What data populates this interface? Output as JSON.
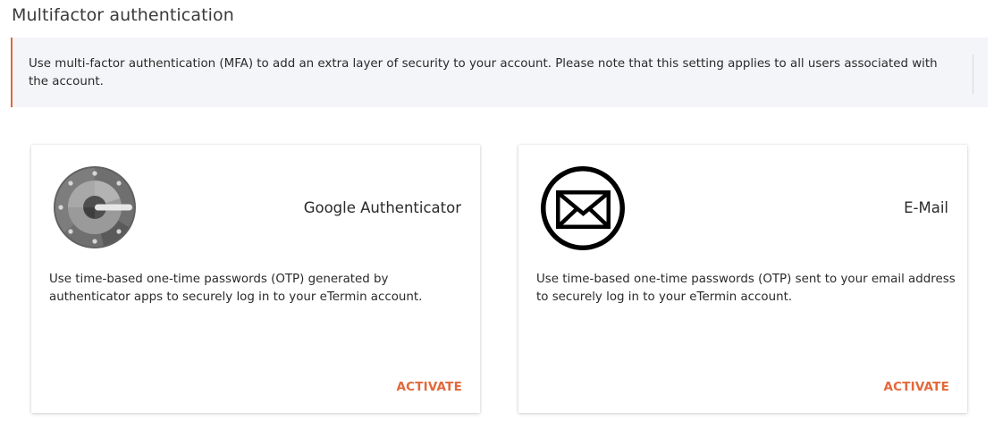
{
  "page": {
    "title": "Multifactor authentication"
  },
  "info": {
    "text": "Use multi-factor authentication (MFA) to add an extra layer of security to your account. Please note that this setting applies to all users associated with the account."
  },
  "methods": [
    {
      "title": "Google Authenticator",
      "icon": "google-authenticator-icon",
      "description": "Use time-based one-time passwords (OTP) generated by authenticator apps to securely log in to your eTermin account.",
      "action_label": "ACTIVATE"
    },
    {
      "title": "E-Mail",
      "icon": "envelope-icon",
      "description": "Use time-based one-time passwords (OTP) sent to your email address to securely log in to your eTermin account.",
      "action_label": "ACTIVATE"
    }
  ],
  "colors": {
    "accent": "#e3683b",
    "info_background": "#f4f5f8",
    "text": "#2a2a2a"
  }
}
